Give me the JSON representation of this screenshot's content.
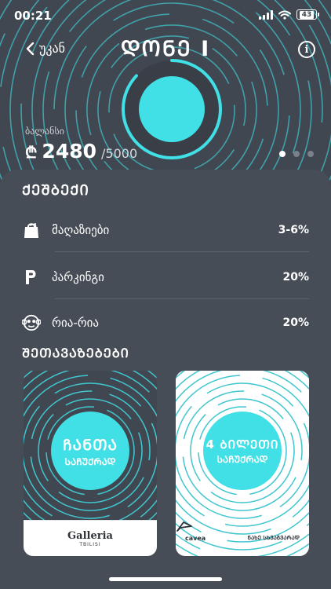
{
  "status_bar": {
    "time": "00:21",
    "battery": "43"
  },
  "header": {
    "back_label": "უკან",
    "title": "ᲓᲝᲜᲔ I",
    "info_icon": "info-icon"
  },
  "balance": {
    "label": "ბალანსი",
    "currency": "₾",
    "amount": "2480",
    "max": "/5000"
  },
  "level_progress": 0.87,
  "pager": {
    "count": 3,
    "active": 0
  },
  "cashback": {
    "title": "ᲥᲔᲨᲑᲔᲥᲘ",
    "items": [
      {
        "icon": "shopping-bag-icon",
        "label": "მაღაზიები",
        "value": "3-6%"
      },
      {
        "icon": "parking-icon",
        "label": "პარკინგი",
        "value": "20%"
      },
      {
        "icon": "monkey-icon",
        "label": "რია-რია",
        "value": "20%"
      }
    ]
  },
  "offers": {
    "title": "ᲨᲔᲗᲐᲕᲐᲖᲔᲑᲔᲑᲘ",
    "cards": [
      {
        "line1": "ᲩᲐᲜᲗᲐ",
        "line2": "ᲡᲐᲩᲣᲥᲠᲐᲓ",
        "brand": "Galleria",
        "brand_sub": "TBILISI"
      },
      {
        "line1": "4 ᲑᲘᲚᲔᲗᲘ",
        "line2": "ᲡᲐᲩᲣᲥᲠᲐᲓ",
        "brand": "cavea",
        "tagline": "ᲜᲐᲮᲔ ᲡᲮᲕᲐᲒᲕᲐᲠᲐᲓ"
      }
    ]
  },
  "colors": {
    "accent": "#40e0e6",
    "background": "#414750",
    "sheet": "#474d56"
  }
}
